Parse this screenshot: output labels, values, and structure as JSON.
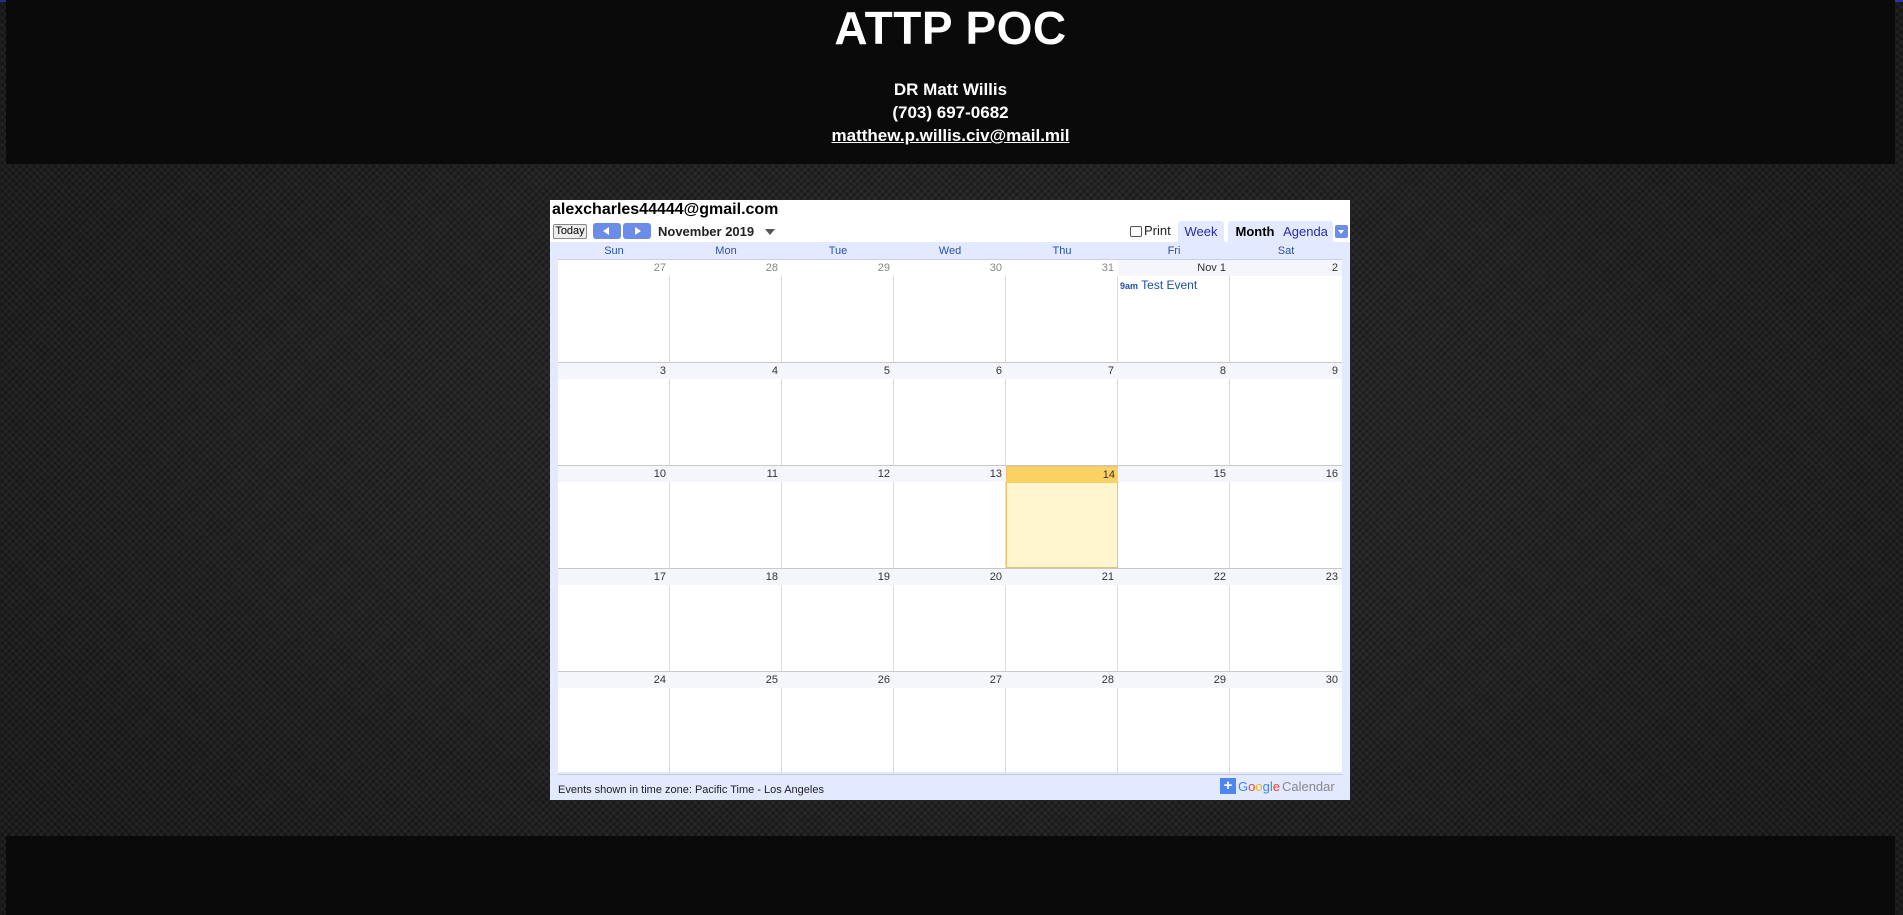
{
  "header": {
    "title": "ATTP POC",
    "contact_name": "DR Matt Willis",
    "phone": "(703) 697-0682",
    "email": "matthew.p.willis.civ@mail.mil"
  },
  "calendar": {
    "account": "alexcharles44444@gmail.com",
    "today_label": "Today",
    "month_label": "November 2019",
    "print_label": "Print",
    "tabs": [
      "Week",
      "Month",
      "Agenda"
    ],
    "active_tab": "Month",
    "weekdays": [
      "Sun",
      "Mon",
      "Tue",
      "Wed",
      "Thu",
      "Fri",
      "Sat"
    ],
    "weeks": [
      [
        "27",
        "28",
        "29",
        "30",
        "31",
        "Nov 1",
        "2"
      ],
      [
        "3",
        "4",
        "5",
        "6",
        "7",
        "8",
        "9"
      ],
      [
        "10",
        "11",
        "12",
        "13",
        "14",
        "15",
        "16"
      ],
      [
        "17",
        "18",
        "19",
        "20",
        "21",
        "22",
        "23"
      ],
      [
        "24",
        "25",
        "26",
        "27",
        "28",
        "29",
        "30"
      ]
    ],
    "today": "14",
    "event": {
      "time": "9am",
      "title": "Test Event"
    },
    "timezone_note": "Events shown in time zone: Pacific Time - Los Angeles",
    "branding": {
      "google": "Google",
      "calendar": "Calendar"
    }
  }
}
